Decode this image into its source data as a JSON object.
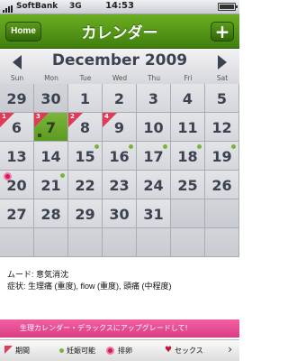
{
  "status_bar": {
    "carrier": "SoftBank",
    "network": "3G",
    "time": "14:53"
  },
  "nav": {
    "home_label": "Home",
    "title": "カレンダー",
    "add_label": "+"
  },
  "calendar": {
    "month_title": "December 2009",
    "weekdays": [
      "Sun",
      "Mon",
      "Tue",
      "Wed",
      "Thu",
      "Fri",
      "Sat"
    ],
    "weeks": [
      [
        {
          "day": "29",
          "other": true
        },
        {
          "day": "30",
          "other": true
        },
        {
          "day": "1"
        },
        {
          "day": "2"
        },
        {
          "day": "3"
        },
        {
          "day": "4"
        },
        {
          "day": "5"
        }
      ],
      [
        {
          "day": "6",
          "period": true,
          "period_num": "1"
        },
        {
          "day": "7",
          "period": true,
          "period_num": "3",
          "today": true,
          "dark_dot": true
        },
        {
          "day": "8",
          "period": true,
          "period_num": "2"
        },
        {
          "day": "9",
          "period": true,
          "period_num": "4"
        },
        {
          "day": "10"
        },
        {
          "day": "11"
        },
        {
          "day": "12"
        }
      ],
      [
        {
          "day": "13"
        },
        {
          "day": "14"
        },
        {
          "day": "15",
          "fertile": true
        },
        {
          "day": "16",
          "fertile": true
        },
        {
          "day": "17",
          "fertile": true
        },
        {
          "day": "18",
          "fertile": true
        },
        {
          "day": "19",
          "fertile": true
        }
      ],
      [
        {
          "day": "20",
          "ovulation": true
        },
        {
          "day": "21",
          "fertile": true
        },
        {
          "day": "22"
        },
        {
          "day": "23"
        },
        {
          "day": "24"
        },
        {
          "day": "25"
        },
        {
          "day": "26"
        }
      ],
      [
        {
          "day": "27"
        },
        {
          "day": "28"
        },
        {
          "day": "29"
        },
        {
          "day": "30"
        },
        {
          "day": "31"
        },
        {
          "day": "",
          "other": true
        },
        {
          "day": "",
          "other": true
        }
      ],
      [
        {
          "day": "",
          "other": true
        },
        {
          "day": "",
          "other": true
        },
        {
          "day": "",
          "other": true
        },
        {
          "day": "",
          "other": true
        },
        {
          "day": "",
          "other": true
        },
        {
          "day": "",
          "other": true
        },
        {
          "day": "",
          "other": true
        }
      ]
    ]
  },
  "info": {
    "mood": "ムード: 意気消沈",
    "symptoms": "症状: 生理痛 (重度), flow (重度), 頭痛 (中程度)"
  },
  "upgrade_banner": "生理カレンダー・デラックスにアップグレードして!",
  "legend": {
    "period": "期間",
    "fertile": "妊娠可能",
    "ovulation": "排卵",
    "sex": "セックス",
    "more": "›"
  }
}
